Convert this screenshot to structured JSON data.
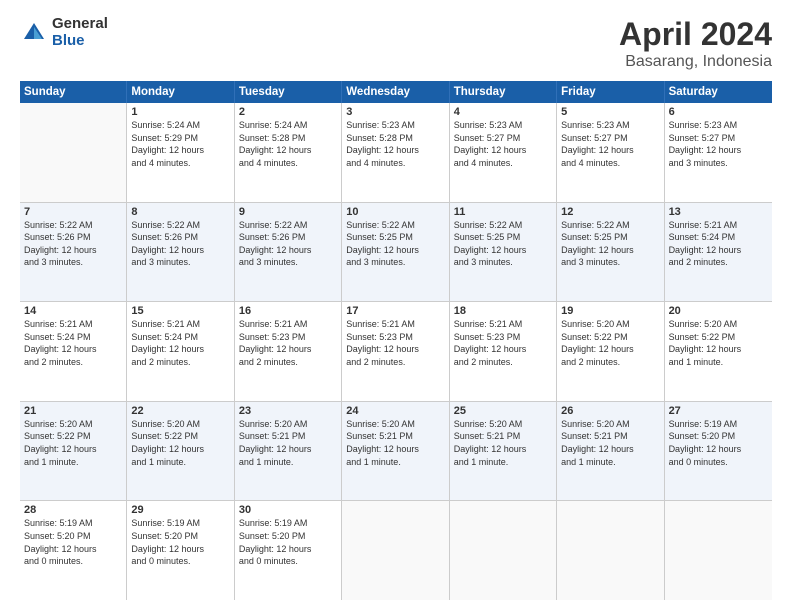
{
  "header": {
    "logo_general": "General",
    "logo_blue": "Blue",
    "main_title": "April 2024",
    "subtitle": "Basarang, Indonesia"
  },
  "calendar": {
    "days_of_week": [
      "Sunday",
      "Monday",
      "Tuesday",
      "Wednesday",
      "Thursday",
      "Friday",
      "Saturday"
    ],
    "rows": [
      [
        {
          "num": "",
          "info": ""
        },
        {
          "num": "1",
          "info": "Sunrise: 5:24 AM\nSunset: 5:29 PM\nDaylight: 12 hours\nand 4 minutes."
        },
        {
          "num": "2",
          "info": "Sunrise: 5:24 AM\nSunset: 5:28 PM\nDaylight: 12 hours\nand 4 minutes."
        },
        {
          "num": "3",
          "info": "Sunrise: 5:23 AM\nSunset: 5:28 PM\nDaylight: 12 hours\nand 4 minutes."
        },
        {
          "num": "4",
          "info": "Sunrise: 5:23 AM\nSunset: 5:27 PM\nDaylight: 12 hours\nand 4 minutes."
        },
        {
          "num": "5",
          "info": "Sunrise: 5:23 AM\nSunset: 5:27 PM\nDaylight: 12 hours\nand 4 minutes."
        },
        {
          "num": "6",
          "info": "Sunrise: 5:23 AM\nSunset: 5:27 PM\nDaylight: 12 hours\nand 3 minutes."
        }
      ],
      [
        {
          "num": "7",
          "info": "Sunrise: 5:22 AM\nSunset: 5:26 PM\nDaylight: 12 hours\nand 3 minutes."
        },
        {
          "num": "8",
          "info": "Sunrise: 5:22 AM\nSunset: 5:26 PM\nDaylight: 12 hours\nand 3 minutes."
        },
        {
          "num": "9",
          "info": "Sunrise: 5:22 AM\nSunset: 5:26 PM\nDaylight: 12 hours\nand 3 minutes."
        },
        {
          "num": "10",
          "info": "Sunrise: 5:22 AM\nSunset: 5:25 PM\nDaylight: 12 hours\nand 3 minutes."
        },
        {
          "num": "11",
          "info": "Sunrise: 5:22 AM\nSunset: 5:25 PM\nDaylight: 12 hours\nand 3 minutes."
        },
        {
          "num": "12",
          "info": "Sunrise: 5:22 AM\nSunset: 5:25 PM\nDaylight: 12 hours\nand 3 minutes."
        },
        {
          "num": "13",
          "info": "Sunrise: 5:21 AM\nSunset: 5:24 PM\nDaylight: 12 hours\nand 2 minutes."
        }
      ],
      [
        {
          "num": "14",
          "info": "Sunrise: 5:21 AM\nSunset: 5:24 PM\nDaylight: 12 hours\nand 2 minutes."
        },
        {
          "num": "15",
          "info": "Sunrise: 5:21 AM\nSunset: 5:24 PM\nDaylight: 12 hours\nand 2 minutes."
        },
        {
          "num": "16",
          "info": "Sunrise: 5:21 AM\nSunset: 5:23 PM\nDaylight: 12 hours\nand 2 minutes."
        },
        {
          "num": "17",
          "info": "Sunrise: 5:21 AM\nSunset: 5:23 PM\nDaylight: 12 hours\nand 2 minutes."
        },
        {
          "num": "18",
          "info": "Sunrise: 5:21 AM\nSunset: 5:23 PM\nDaylight: 12 hours\nand 2 minutes."
        },
        {
          "num": "19",
          "info": "Sunrise: 5:20 AM\nSunset: 5:22 PM\nDaylight: 12 hours\nand 2 minutes."
        },
        {
          "num": "20",
          "info": "Sunrise: 5:20 AM\nSunset: 5:22 PM\nDaylight: 12 hours\nand 1 minute."
        }
      ],
      [
        {
          "num": "21",
          "info": "Sunrise: 5:20 AM\nSunset: 5:22 PM\nDaylight: 12 hours\nand 1 minute."
        },
        {
          "num": "22",
          "info": "Sunrise: 5:20 AM\nSunset: 5:22 PM\nDaylight: 12 hours\nand 1 minute."
        },
        {
          "num": "23",
          "info": "Sunrise: 5:20 AM\nSunset: 5:21 PM\nDaylight: 12 hours\nand 1 minute."
        },
        {
          "num": "24",
          "info": "Sunrise: 5:20 AM\nSunset: 5:21 PM\nDaylight: 12 hours\nand 1 minute."
        },
        {
          "num": "25",
          "info": "Sunrise: 5:20 AM\nSunset: 5:21 PM\nDaylight: 12 hours\nand 1 minute."
        },
        {
          "num": "26",
          "info": "Sunrise: 5:20 AM\nSunset: 5:21 PM\nDaylight: 12 hours\nand 1 minute."
        },
        {
          "num": "27",
          "info": "Sunrise: 5:19 AM\nSunset: 5:20 PM\nDaylight: 12 hours\nand 0 minutes."
        }
      ],
      [
        {
          "num": "28",
          "info": "Sunrise: 5:19 AM\nSunset: 5:20 PM\nDaylight: 12 hours\nand 0 minutes."
        },
        {
          "num": "29",
          "info": "Sunrise: 5:19 AM\nSunset: 5:20 PM\nDaylight: 12 hours\nand 0 minutes."
        },
        {
          "num": "30",
          "info": "Sunrise: 5:19 AM\nSunset: 5:20 PM\nDaylight: 12 hours\nand 0 minutes."
        },
        {
          "num": "",
          "info": ""
        },
        {
          "num": "",
          "info": ""
        },
        {
          "num": "",
          "info": ""
        },
        {
          "num": "",
          "info": ""
        }
      ]
    ]
  }
}
